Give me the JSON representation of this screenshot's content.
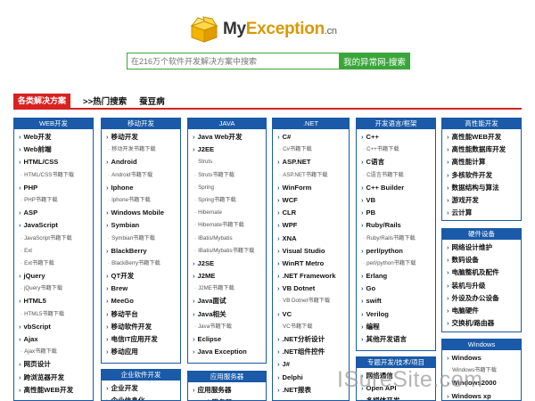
{
  "logo": {
    "prefix": "My",
    "accent": "Exception",
    "suffix": ".cn"
  },
  "search": {
    "placeholder": "在216万个软件开发解决方案中搜索",
    "button": "我的异常网-搜索"
  },
  "nav": {
    "active": "各类解决方案",
    "hot": ">>热门搜索",
    "other": "蚕豆病"
  },
  "watermark": "ISureSite.com",
  "columns": [
    {
      "title": "WEB开发",
      "items": [
        {
          "t": "Web开发",
          "m": true
        },
        {
          "t": "Web前端",
          "m": true
        },
        {
          "t": "HTML/CSS",
          "m": true
        },
        {
          "t": "HTML/CSS书籍下载",
          "m": false
        },
        {
          "t": "PHP",
          "m": true
        },
        {
          "t": "PHP书籍下载",
          "m": false
        },
        {
          "t": "ASP",
          "m": true
        },
        {
          "t": "JavaScript",
          "m": true
        },
        {
          "t": "JavaScript书籍下载",
          "m": false
        },
        {
          "t": "Ext",
          "m": false
        },
        {
          "t": "Ext书籍下载",
          "m": false
        },
        {
          "t": "jQuery",
          "m": true
        },
        {
          "t": "jQuery书籍下载",
          "m": false
        },
        {
          "t": "HTML5",
          "m": true
        },
        {
          "t": "HTML5书籍下载",
          "m": false
        },
        {
          "t": "vbScript",
          "m": true
        },
        {
          "t": "Ajax",
          "m": true
        },
        {
          "t": "Ajax书籍下载",
          "m": false
        },
        {
          "t": "网页设计",
          "m": true
        },
        {
          "t": "跨浏览器开发",
          "m": true
        },
        {
          "t": "高性能WEB开发",
          "m": true
        }
      ]
    },
    {
      "title": "移动开发",
      "items": [
        {
          "t": "移动开发",
          "m": true
        },
        {
          "t": "移动开发书籍下载",
          "m": false
        },
        {
          "t": "Android",
          "m": true
        },
        {
          "t": "Android书籍下载",
          "m": false
        },
        {
          "t": "Iphone",
          "m": true
        },
        {
          "t": "Iphone书籍下载",
          "m": false
        },
        {
          "t": "Windows Mobile",
          "m": true
        },
        {
          "t": "Symbian",
          "m": true
        },
        {
          "t": "Symbian书籍下载",
          "m": false
        },
        {
          "t": "BlackBerry",
          "m": true
        },
        {
          "t": "BlackBerry书籍下载",
          "m": false
        },
        {
          "t": "QT开发",
          "m": true
        },
        {
          "t": "Brew",
          "m": true
        },
        {
          "t": "MeeGo",
          "m": true
        },
        {
          "t": "移动平台",
          "m": true
        },
        {
          "t": "移动软件开发",
          "m": true
        },
        {
          "t": "电信IT应用开发",
          "m": true
        },
        {
          "t": "移动应用",
          "m": true
        }
      ]
    },
    {
      "title": "企业软件开发",
      "items": [
        {
          "t": "企业开发",
          "m": true
        },
        {
          "t": "企业信息化",
          "m": true
        }
      ]
    },
    {
      "title": "JAVA",
      "items": [
        {
          "t": "Java Web开发",
          "m": true
        },
        {
          "t": "J2EE",
          "m": true
        },
        {
          "t": "Struts",
          "m": false
        },
        {
          "t": "Struts书籍下载",
          "m": false
        },
        {
          "t": "Spring",
          "m": false
        },
        {
          "t": "Spring书籍下载",
          "m": false
        },
        {
          "t": "Hibernate",
          "m": false
        },
        {
          "t": "Hibernate书籍下载",
          "m": false
        },
        {
          "t": "IBatis/Mybatis",
          "m": false
        },
        {
          "t": "IBatis/Mybatis书籍下载",
          "m": false
        },
        {
          "t": "J2SE",
          "m": true
        },
        {
          "t": "J2ME",
          "m": true
        },
        {
          "t": "J2ME书籍下载",
          "m": false
        },
        {
          "t": "Java面试",
          "m": true
        },
        {
          "t": "Java相关",
          "m": true
        },
        {
          "t": "Java书籍下载",
          "m": false
        },
        {
          "t": "Eclipse",
          "m": true
        },
        {
          "t": "Java Exception",
          "m": true
        }
      ]
    },
    {
      "title": "应用服务器",
      "items": [
        {
          "t": "应用服务器",
          "m": true
        },
        {
          "t": "Web服务器",
          "m": true
        }
      ]
    },
    {
      "title": ".NET",
      "items": [
        {
          "t": "C#",
          "m": true
        },
        {
          "t": "C#书籍下载",
          "m": false
        },
        {
          "t": "ASP.NET",
          "m": true
        },
        {
          "t": "ASP.NET书籍下载",
          "m": false
        },
        {
          "t": "WinForm",
          "m": true
        },
        {
          "t": "WCF",
          "m": true
        },
        {
          "t": "CLR",
          "m": true
        },
        {
          "t": "WPF",
          "m": true
        },
        {
          "t": "XNA",
          "m": true
        },
        {
          "t": "Visual Studio",
          "m": true
        },
        {
          "t": "WinRT Metro",
          "m": true
        },
        {
          "t": ".NET Framework",
          "m": true
        },
        {
          "t": "VB Dotnet",
          "m": true
        },
        {
          "t": "VB Dotnet书籍下载",
          "m": false
        },
        {
          "t": "VC",
          "m": true
        },
        {
          "t": "VC书籍下载",
          "m": false
        },
        {
          "t": ".NET分析设计",
          "m": true
        },
        {
          "t": ".NET组件控件",
          "m": true
        },
        {
          "t": "J#",
          "m": true
        },
        {
          "t": "Delphi",
          "m": true
        },
        {
          "t": ".NET报表",
          "m": true
        },
        {
          "t": "LINQ",
          "m": true
        }
      ]
    },
    {
      "title": "开发语言/框架",
      "items": [
        {
          "t": "C++",
          "m": true
        },
        {
          "t": "C++书籍下载",
          "m": false
        },
        {
          "t": "C语言",
          "m": true
        },
        {
          "t": "C语言书籍下载",
          "m": false
        },
        {
          "t": "C++ Builder",
          "m": true
        },
        {
          "t": "VB",
          "m": true
        },
        {
          "t": "PB",
          "m": true
        },
        {
          "t": "Ruby/Rails",
          "m": true
        },
        {
          "t": "Ruby/Rails书籍下载",
          "m": false
        },
        {
          "t": "perl/python",
          "m": true
        },
        {
          "t": "perl/python书籍下载",
          "m": false
        },
        {
          "t": "Erlang",
          "m": true
        },
        {
          "t": "Go",
          "m": true
        },
        {
          "t": "swift",
          "m": true
        },
        {
          "t": "Verilog",
          "m": true
        },
        {
          "t": "编程",
          "m": true
        },
        {
          "t": "其他开发语言",
          "m": true
        }
      ]
    },
    {
      "title": "专题开发/技术/项目",
      "items": [
        {
          "t": "网络通信",
          "m": true
        },
        {
          "t": "Open API",
          "m": true
        },
        {
          "t": "多媒体开发",
          "m": true
        }
      ]
    },
    {
      "title": "高性能开发",
      "items": [
        {
          "t": "高性能WEB开发",
          "m": true
        },
        {
          "t": "高性能数据库开发",
          "m": true
        },
        {
          "t": "高性能计算",
          "m": true
        },
        {
          "t": "多核软件开发",
          "m": true
        },
        {
          "t": "数据结构与算法",
          "m": true
        },
        {
          "t": "游戏开发",
          "m": true
        },
        {
          "t": "云计算",
          "m": true
        }
      ]
    },
    {
      "title": "硬件设备",
      "items": [
        {
          "t": "网络设计维护",
          "m": true
        },
        {
          "t": "数码设备",
          "m": true
        },
        {
          "t": "电脑整机及配件",
          "m": true
        },
        {
          "t": "装机与升级",
          "m": true
        },
        {
          "t": "外设及办公设备",
          "m": true
        },
        {
          "t": "电脑硬件",
          "m": true
        },
        {
          "t": "交换机/路由器",
          "m": true
        }
      ]
    },
    {
      "title": "Windows",
      "items": [
        {
          "t": "Windows",
          "m": true
        },
        {
          "t": "Windows书籍下载",
          "m": false
        },
        {
          "t": "Windows2000",
          "m": true
        },
        {
          "t": "Windows xp",
          "m": true
        }
      ]
    }
  ]
}
